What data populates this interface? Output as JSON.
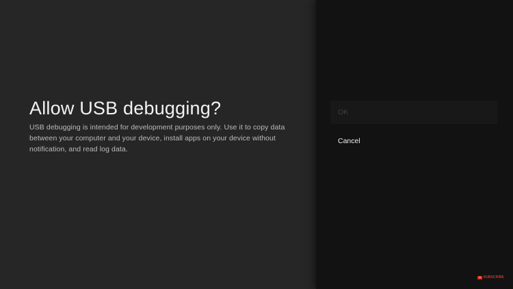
{
  "dialog": {
    "title": "Allow USB debugging?",
    "message": "USB debugging is intended for development purposes only. Use it to copy data between your computer and your device, install apps on your device without notification, and read log data."
  },
  "actions": [
    {
      "label": "OK",
      "state": "disabled"
    },
    {
      "label": "Cancel",
      "state": "enabled"
    }
  ],
  "overlay": {
    "subscribe_label": "SUBSCRIBE",
    "icon": "youtube-play-icon"
  },
  "colors": {
    "left_panel": "#262626",
    "right_panel": "#121212",
    "title_text": "#f2f2f2",
    "body_text": "#bdbdbd",
    "disabled_text": "#3f3f3f",
    "subscribe_red": "#d93025"
  }
}
